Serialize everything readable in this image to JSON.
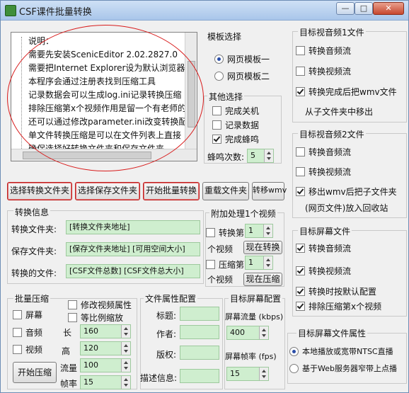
{
  "window": {
    "title": "CSF课件批量转换",
    "minimize": "—",
    "maximize": "□",
    "close": "✕"
  },
  "listbox": {
    "items": [
      "说明：",
      "需要先安装ScenicEditor 2.02.2827.0",
      "需要把Internet Explorer设为默认浏览器",
      "本程序会通过注册表找到压缩工具",
      "记录数据会可以生成log.ini记录转换压缩",
      "排除压缩第x个视频作用是留一个有老师的",
      "还可以通过修改parameter.ini改变转换配",
      "单文件转换压缩是可以在文件列表上直接",
      "确保选择好转换文件夹和保存文件夹"
    ]
  },
  "template": {
    "title": "模板选择",
    "options": [
      "网页模板一",
      "网页模板二"
    ],
    "selected": 0
  },
  "other": {
    "title": "其他选择",
    "shutdown": "完成关机",
    "record": "记录数据",
    "beep": "完成蜂鸣",
    "beep_count_label": "蜂鸣次数:",
    "beep_count": "5"
  },
  "buttons": {
    "select_convert": "选择转换文件夹",
    "select_save": "选择保存文件夹",
    "start_batch": "开始批量转换",
    "reload": "重载文件夹",
    "convert_wmv": "转移wmv"
  },
  "convert_info": {
    "title": "转换信息",
    "folder_label": "转换文件夹:",
    "folder_value": "[转换文件夹地址]",
    "save_label": "保存文件夹:",
    "save_value": "[保存文件夹地址] [可用空间大小]",
    "files_label": "转换的文件:",
    "files_value": "[CSF文件总数] [CSF文件总大小]"
  },
  "extra": {
    "title": "附加处理1个视频",
    "convert_label": "转换第",
    "convert_index": "1",
    "convert_unit": "个视频",
    "convert_now": "现在转换",
    "compress_label": "压缩第",
    "compress_index": "1",
    "compress_unit": "个视频",
    "compress_now": "现在压缩"
  },
  "target1": {
    "title": "目标视音频1文件",
    "audio": "转换音频流",
    "video": "转换视频流",
    "finish": "转换完成后把wmv文件",
    "finish2": "从子文件夹中移出"
  },
  "target2": {
    "title": "目标视音频2文件",
    "audio": "转换音频流",
    "video": "转换视频流",
    "move": "移出wmv后把子文件夹",
    "move2": "(网页文件)放入回收站"
  },
  "screen": {
    "title": "目标屏幕文件",
    "audio": "转换音频流",
    "video": "转换视频流",
    "default": "转换时按默认配置",
    "exclude": "排除压缩第x个视频"
  },
  "batch_compress": {
    "title": "批量压缩",
    "screen": "屏幕",
    "audio": "音频",
    "video": "视频",
    "modify": "修改视频属性",
    "ratio": "等比例缩放",
    "length_label": "长",
    "length": "160",
    "height_label": "高",
    "height": "120",
    "flow_label": "流量",
    "flow": "100",
    "fps_label": "帧率",
    "fps": "15",
    "start": "开始压缩"
  },
  "file_props": {
    "title": "文件属性配置",
    "title_label": "标题:",
    "author_label": "作者:",
    "copyright_label": "版权:",
    "desc_label": "描述信息:"
  },
  "screen_config": {
    "title": "目标屏幕配置",
    "flow_label": "屏幕流量 (kbps)",
    "flow": "400",
    "fps_label": "屏幕帧率 (fps)",
    "fps": "15"
  },
  "screen_props": {
    "title": "目标屏幕文件属性",
    "opt1": "本地播放或宽带NTSC直播",
    "opt2": "基于Web服务器窄带上点播"
  }
}
